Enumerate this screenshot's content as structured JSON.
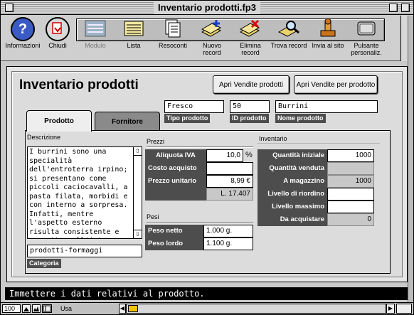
{
  "window": {
    "title": "Inventario prodotti.fp3"
  },
  "toolbar": {
    "items": [
      {
        "label": "Informazioni",
        "icon": "question-icon"
      },
      {
        "label": "Chiudi",
        "icon": "close-doc-icon"
      },
      {
        "label": "Modulo",
        "icon": "form-icon"
      },
      {
        "label": "Lista",
        "icon": "list-icon"
      },
      {
        "label": "Resoconti",
        "icon": "report-icon"
      },
      {
        "label": "Nuovo record",
        "icon": "new-record-icon"
      },
      {
        "label": "Elimina record",
        "icon": "delete-record-icon"
      },
      {
        "label": "Trova record",
        "icon": "find-record-icon"
      },
      {
        "label": "Invia al sito",
        "icon": "send-site-icon"
      },
      {
        "label": "Pulsante personaliz.",
        "icon": "custom-button-icon"
      }
    ]
  },
  "page": {
    "title": "Inventario prodotti",
    "btn_vendite_prodotti": "Apri Vendite prodotti",
    "btn_vendite_per_prodotto": "Apri Vendite per prodotto",
    "tipo_prodotto": {
      "value": "Fresco",
      "label": "Tipo prodotto"
    },
    "id_prodotto": {
      "value": "50",
      "label": "ID prodotto"
    },
    "nome_prodotto": {
      "value": "Burrini",
      "label": "Nome prodotto"
    }
  },
  "tabs": [
    {
      "label": "Prodotto",
      "active": true
    },
    {
      "label": "Fornitore",
      "active": false
    }
  ],
  "descrizione": {
    "heading": "Descrizione",
    "text": "I burrini sono una specialità dell'entroterra irpino; si presentano come piccoli caciocavalli, a pasta filata, morbidi e con interno a sorpresa. Infatti, mentre l'aspetto esterno risulta consistente e compatto, all'interno si trova un cuore di fresco"
  },
  "categoria": {
    "value": "prodotti-formaggi",
    "label": "Categoria"
  },
  "prezzi": {
    "heading": "Prezzi",
    "aliquota_iva": {
      "label": "Aliquota IVA",
      "value": "10,0",
      "unit": "%"
    },
    "costo_acquisto": {
      "label": "Costo acquisto",
      "value": ""
    },
    "prezzo_unitario": {
      "label": "Prezzo unitario",
      "value": "8,99 €"
    },
    "prezzo_lire": "L. 17.407"
  },
  "pesi": {
    "heading": "Pesi",
    "peso_netto": {
      "label": "Peso netto",
      "value": "1.000 g."
    },
    "peso_lordo": {
      "label": "Peso lordo",
      "value": "1.100 g."
    }
  },
  "inventario": {
    "heading": "Inventario",
    "rows": [
      {
        "label": "Quantità iniziale",
        "value": "1000",
        "gray": false
      },
      {
        "label": "Quantità venduta",
        "value": "",
        "gray": true
      },
      {
        "label": "A magazzino",
        "value": "1000",
        "gray": true
      },
      {
        "label": "Livello di riordino",
        "value": "",
        "gray": false
      },
      {
        "label": "Livello massimo",
        "value": "",
        "gray": false
      },
      {
        "label": "Da acquistare",
        "value": "0",
        "gray": true
      }
    ]
  },
  "status": {
    "message": "Immettere i dati relativi al prodotto."
  },
  "bottom": {
    "zoom": "100",
    "mode": "Usa"
  },
  "colors": {
    "dark_label": "#4d4d4d",
    "tab_inactive": "#8a8a8a",
    "status_bg": "#000000"
  }
}
